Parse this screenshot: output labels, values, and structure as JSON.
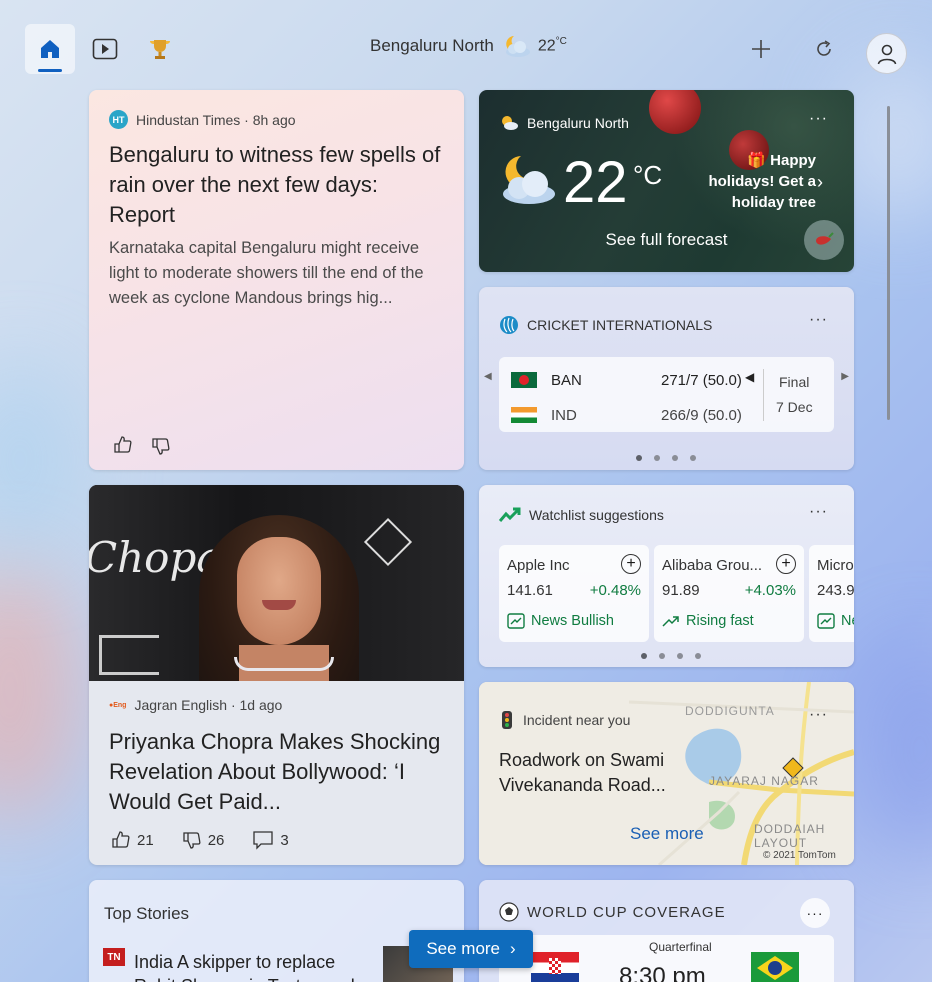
{
  "topbar": {
    "location": "Bengaluru North",
    "temperature": "22",
    "temp_unit": "°C"
  },
  "news1": {
    "source": "Hindustan Times · 8h ago",
    "title": "Bengaluru to witness few spells of rain over the next few days: Report",
    "description": "Karnataka capital Bengaluru might receive light to moderate showers till the end of the week as cyclone Mandous brings hig..."
  },
  "weather": {
    "location": "Bengaluru North",
    "temperature": "22",
    "unit": "°C",
    "promo": "Happy holidays! Get a holiday tree",
    "forecast_link": "See full forecast"
  },
  "cricket": {
    "header": "CRICKET INTERNATIONALS",
    "team1": {
      "name": "BAN",
      "score": "271/7 (50.0)"
    },
    "team2": {
      "name": "IND",
      "score": "266/9 (50.0)"
    },
    "status": "Final",
    "date": "7 Dec"
  },
  "news2": {
    "source": "Jagran English · 1d ago",
    "title": "Priyanka Chopra Makes Shocking Revelation About Bollywood: ‘I Would Get Paid...",
    "likes": "21",
    "dislikes": "26",
    "comments": "3",
    "photo_text": "Chopard"
  },
  "watchlist": {
    "header": "Watchlist suggestions",
    "stocks": [
      {
        "name": "Apple Inc",
        "price": "141.61",
        "change": "+0.48%",
        "tag": "News Bullish"
      },
      {
        "name": "Alibaba Grou...",
        "price": "91.89",
        "change": "+4.03%",
        "tag": "Rising fast"
      },
      {
        "name": "Micro",
        "price": "243.9",
        "change": "",
        "tag": "Ne"
      }
    ]
  },
  "incident": {
    "header": "Incident near you",
    "title": "Roadwork on Swami Vivekananda Road...",
    "see_more": "See more",
    "map_labels": [
      "DODDIGUNTA",
      "JAYARAJ NAGAR",
      "DODDAIAH LAYOUT"
    ],
    "copyright": "© 2021 TomTom"
  },
  "topstories": {
    "header": "Top Stories",
    "item1": "India A skipper to replace Rohit Sharma in Test squad"
  },
  "worldcup": {
    "header": "WORLD CUP COVERAGE",
    "stage": "Quarterfinal",
    "time": "8:30 pm"
  },
  "see_more_button": "See more",
  "colors": {
    "accent": "#0f6cbd",
    "positive": "#107c41"
  }
}
